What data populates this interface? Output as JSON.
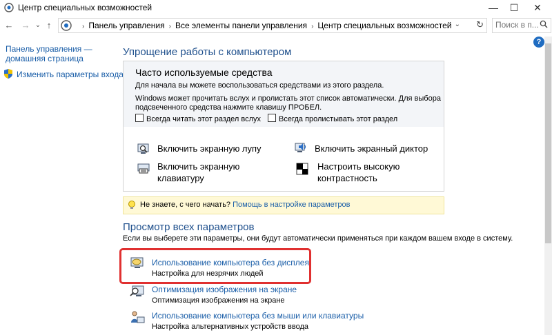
{
  "window": {
    "title": "Центр специальных возможностей",
    "minimize_glyph": "—",
    "maximize_glyph": "☐",
    "close_glyph": "✕"
  },
  "addressbar": {
    "back_glyph": "←",
    "forward_glyph": "→",
    "recent_glyph": "⌄",
    "up_glyph": "↑",
    "breadcrumbs": [
      "Панель управления",
      "Все элементы панели управления",
      "Центр специальных возможностей"
    ],
    "separator": "›",
    "dropdown_glyph": "⌄",
    "refresh_glyph": "↻",
    "search_placeholder": "Поиск в п..."
  },
  "help_glyph": "?",
  "sidebar": {
    "home_link_line1": "Панель управления —",
    "home_link_line2": "домашняя страница",
    "signin_link": "Изменить параметры входа"
  },
  "main": {
    "section1_title": "Упрощение работы с компьютером",
    "panel": {
      "title": "Часто используемые средства",
      "line1": "Для начала вы можете воспользоваться средствами из этого раздела.",
      "line2": "Windows может прочитать вслух и пролистать этот список автоматически. Для выбора",
      "line3": "подсвеченного средства нажмите клавишу ПРОБЕЛ.",
      "checkbox_read": "Всегда читать этот раздел вслух",
      "checkbox_scan": "Всегда пролистывать этот раздел",
      "tools": {
        "magnifier": "Включить экранную лупу",
        "narrator": "Включить экранный диктор",
        "osk_line1": "Включить экранную",
        "osk_line2": "клавиатуру",
        "contrast_line1": "Настроить высокую",
        "contrast_line2": "контрастность"
      }
    },
    "notice": {
      "text": "Не знаете, с чего начать?",
      "link": "Помощь в настройке параметров"
    },
    "section2_title": "Просмотр всех параметров",
    "section2_desc": "Если вы выберете эти параметры, они будут автоматически применяться при каждом вашем входе в систему.",
    "items": [
      {
        "title": "Использование компьютера без дисплея",
        "subtitle": "Настройка для незрячих людей"
      },
      {
        "title": "Оптимизация изображения на экране",
        "subtitle": "Оптимизация изображения на экране"
      },
      {
        "title": "Использование компьютера без мыши или клавиатуры",
        "subtitle": "Настройка альтернативных устройств ввода"
      }
    ]
  },
  "colors": {
    "link": "#1a5ea8",
    "heading": "#1e4f8c",
    "highlight": "#e03030",
    "notice_bg": "#fff9d6"
  }
}
